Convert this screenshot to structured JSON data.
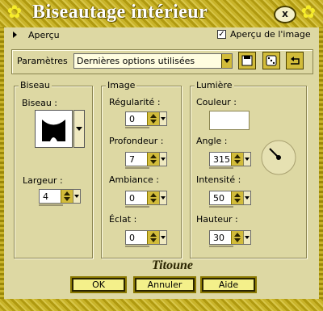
{
  "window": {
    "title": "Biseautage intérieur",
    "close_label": "x"
  },
  "preview": {
    "toggle_label": "Aperçu",
    "checkbox_label": "Aperçu de l'image",
    "checked": true
  },
  "settings": {
    "label": "Paramètres",
    "selected": "Dernières options utilisées"
  },
  "bevel": {
    "group_title": "Biseau",
    "bevel_label": "Biseau :",
    "width_label": "Largeur :",
    "width_value": "4"
  },
  "image": {
    "group_title": "Image",
    "smoothness_label": "Régularité :",
    "smoothness_value": "0",
    "depth_label": "Profondeur :",
    "depth_value": "7",
    "ambience_label": "Ambiance :",
    "ambience_value": "0",
    "shininess_label": "Éclat :",
    "shininess_value": "0"
  },
  "light": {
    "group_title": "Lumière",
    "color_label": "Couleur :",
    "color_value": "#ffffff",
    "angle_label": "Angle :",
    "angle_value": "315",
    "intensity_label": "Intensité :",
    "intensity_value": "50",
    "elevation_label": "Hauteur :",
    "elevation_value": "30"
  },
  "watermark": "Titoune",
  "buttons": {
    "ok": "OK",
    "cancel": "Annuler",
    "help": "Aide"
  }
}
